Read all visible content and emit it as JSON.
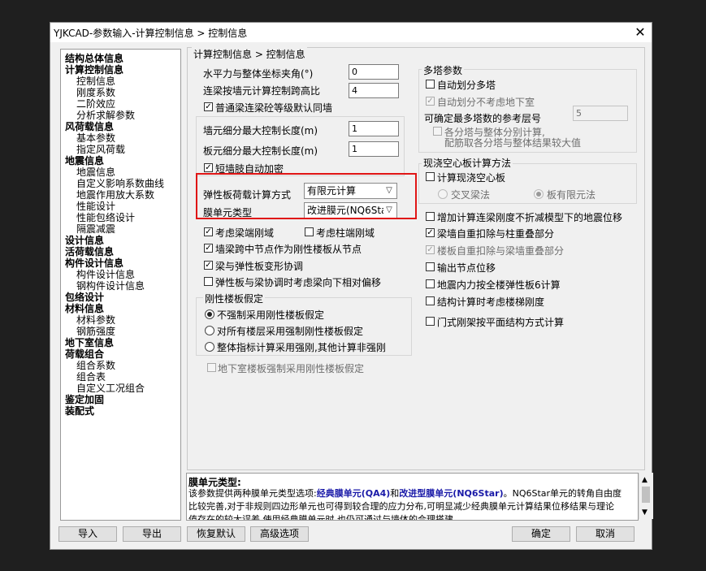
{
  "window": {
    "title": "YJKCAD-参数输入-计算控制信息 > 控制信息",
    "close_glyph": "✕"
  },
  "tree": [
    {
      "label": "结构总体信息",
      "level": 1
    },
    {
      "label": "计算控制信息",
      "level": 1
    },
    {
      "label": "控制信息",
      "level": 2
    },
    {
      "label": "刚度系数",
      "level": 2
    },
    {
      "label": "二阶效应",
      "level": 2
    },
    {
      "label": "分析求解参数",
      "level": 2
    },
    {
      "label": "风荷载信息",
      "level": 1
    },
    {
      "label": "基本参数",
      "level": 2
    },
    {
      "label": "指定风荷载",
      "level": 2
    },
    {
      "label": "地震信息",
      "level": 1
    },
    {
      "label": "地震信息",
      "level": 2
    },
    {
      "label": "自定义影响系数曲线",
      "level": 2
    },
    {
      "label": "地震作用放大系数",
      "level": 2
    },
    {
      "label": "性能设计",
      "level": 2
    },
    {
      "label": "性能包络设计",
      "level": 2
    },
    {
      "label": "隔震减震",
      "level": 2
    },
    {
      "label": "设计信息",
      "level": 1
    },
    {
      "label": "活荷载信息",
      "level": 1
    },
    {
      "label": "构件设计信息",
      "level": 1
    },
    {
      "label": "构件设计信息",
      "level": 2
    },
    {
      "label": "钢构件设计信息",
      "level": 2
    },
    {
      "label": "包络设计",
      "level": 1
    },
    {
      "label": "材料信息",
      "level": 1
    },
    {
      "label": "材料参数",
      "level": 2
    },
    {
      "label": "钢筋强度",
      "level": 2
    },
    {
      "label": "地下室信息",
      "level": 1
    },
    {
      "label": "荷载组合",
      "level": 1
    },
    {
      "label": "组合系数",
      "level": 2
    },
    {
      "label": "组合表",
      "level": 2
    },
    {
      "label": "自定义工况组合",
      "level": 2
    },
    {
      "label": "鉴定加固",
      "level": 1
    },
    {
      "label": "装配式",
      "level": 1
    }
  ],
  "panel": {
    "breadcrumb": "计算控制信息 > 控制信息",
    "angle_label": "水平力与整体坐标夹角(°)",
    "angle_value": "0",
    "beam_height_label": "连梁按墙元计算控制跨高比",
    "beam_height_value": "4",
    "same_grade_label": "普通梁连梁砼等级默认同墙",
    "wall_len_label": "墙元细分最大控制长度(m)",
    "wall_len_value": "1",
    "slab_len_label": "板元细分最大控制长度(m)",
    "slab_len_value": "1",
    "short_wall_label": "短墙肢自动加密",
    "elastic_method_label": "弹性板荷载计算方式",
    "elastic_method_value": "有限元计算",
    "membrane_label": "膜单元类型",
    "membrane_value": "改进膜元(NQ6Sta",
    "beam_end_label": "考虑梁端刚域",
    "col_end_label": "考虑柱端刚域",
    "wall_node_label": "墙梁跨中节点作为刚性楼板从节点",
    "beam_elastic_label": "梁与弹性板变形协调",
    "offset_label": "弹性板与梁协调时考虑梁向下相对偏移",
    "rigid_group_title": "刚性楼板假定",
    "rigid_opt1": "不强制采用刚性楼板假定",
    "rigid_opt2": "对所有楼层采用强制刚性楼板假定",
    "rigid_opt3": "整体指标计算采用强刚,其他计算非强刚",
    "basement_label": "地下室楼板强制采用刚性楼板假定",
    "multi_title": "多塔参数",
    "auto_split_label": "自动划分多塔",
    "auto_split_basement_label": "自动划分不考虑地下室",
    "ref_floor_label": "可确定最多塔数的参考层号",
    "ref_floor_value": "5",
    "split_calc_label_1": "各分塔与整体分别计算,",
    "split_calc_label_2": "配筋取各分塔与整体结果较大值",
    "hollow_title": "现浇空心板计算方法",
    "hollow_calc_label": "计算现浇空心板",
    "hollow_opt1": "交叉梁法",
    "hollow_opt2": "板有限元法",
    "seismic_disp_label": "增加计算连梁刚度不折减模型下的地震位移",
    "beam_deduct_label": "梁墙自重扣除与柱重叠部分",
    "slab_deduct_label": "楼板自重扣除与梁墙重叠部分",
    "node_disp_label": "输出节点位移",
    "seismic_force_label": "地震内力按全楼弹性板6计算",
    "stair_label": "结构计算时考虑楼梯刚度",
    "frame_label": "门式刚架按平面结构方式计算"
  },
  "help": {
    "title": "膜单元类型:",
    "p1": "该参数提供两种膜单元类型选项:",
    "opt1": "经典膜单元(QA4)",
    "and": "和",
    "opt2": "改进型膜单元(NQ6Star)",
    "p2": "。NQ6Star单元的转角自由度比较完善,对于非规则四边形单元也可得到较合理的应力分布,可明显减少经典膜单元计算结果位移结果与理论值存在的较大误差,使用经典膜单元时,也仍可通过与墙体的合理搭建"
  },
  "buttons": {
    "import": "导入",
    "export": "导出",
    "restore": "恢复默认",
    "advanced": "高级选项",
    "ok": "确定",
    "cancel": "取消"
  }
}
